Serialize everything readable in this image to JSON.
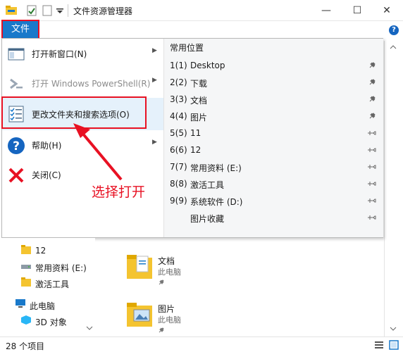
{
  "window": {
    "title": "文件资源管理器",
    "min_glyph": "—",
    "max_glyph": "☐",
    "close_glyph": "✕"
  },
  "ribbon": {
    "file_tab": "文件",
    "help_glyph": "?"
  },
  "menu": {
    "left_items": [
      {
        "label": "打开新窗口(N)",
        "icon": "new-window-icon",
        "has_submenu": true
      },
      {
        "label": "打开 Windows PowerShell(R)",
        "icon": "powershell-icon",
        "has_submenu": true,
        "disabled": true
      },
      {
        "label": "更改文件夹和搜索选项(O)",
        "icon": "folder-options-icon",
        "selected": true
      },
      {
        "label": "帮助(H)",
        "icon": "help-icon",
        "has_submenu": true
      },
      {
        "label": "关闭(C)",
        "icon": "close-icon"
      }
    ],
    "arrow_glyph": "▶",
    "annotation": "选择打开",
    "frequent_header": "常用位置",
    "frequent": [
      {
        "num": "1(1)",
        "label": "Desktop",
        "pinned": true
      },
      {
        "num": "2(2)",
        "label": "下载",
        "pinned": true
      },
      {
        "num": "3(3)",
        "label": "文档",
        "pinned": true
      },
      {
        "num": "4(4)",
        "label": "图片",
        "pinned": true
      },
      {
        "num": "5(5)",
        "label": "11",
        "pinned": false
      },
      {
        "num": "6(6)",
        "label": "12",
        "pinned": false
      },
      {
        "num": "7(7)",
        "label": "常用资料 (E:)",
        "pinned": false
      },
      {
        "num": "8(8)",
        "label": "激活工具",
        "pinned": false
      },
      {
        "num": "9(9)",
        "label": "系统软件 (D:)",
        "pinned": false
      },
      {
        "num": "",
        "label": "图片收藏",
        "pinned": false
      }
    ]
  },
  "nav": [
    {
      "label": "12",
      "icon": "folder-icon"
    },
    {
      "label": "常用资料 (E:)",
      "icon": "drive-icon"
    },
    {
      "label": "激活工具",
      "icon": "folder-icon"
    },
    {
      "label": "此电脑",
      "icon": "computer-icon"
    },
    {
      "label": "3D 对象",
      "icon": "3d-objects-icon"
    }
  ],
  "content": [
    {
      "title": "文档",
      "sub": "此电脑"
    },
    {
      "title": "图片",
      "sub": "此电脑"
    }
  ],
  "status": {
    "count": "28 个项目"
  },
  "colors": {
    "accent": "#1979ca",
    "highlight": "#e81123",
    "selected_bg": "#e5f1fb"
  }
}
